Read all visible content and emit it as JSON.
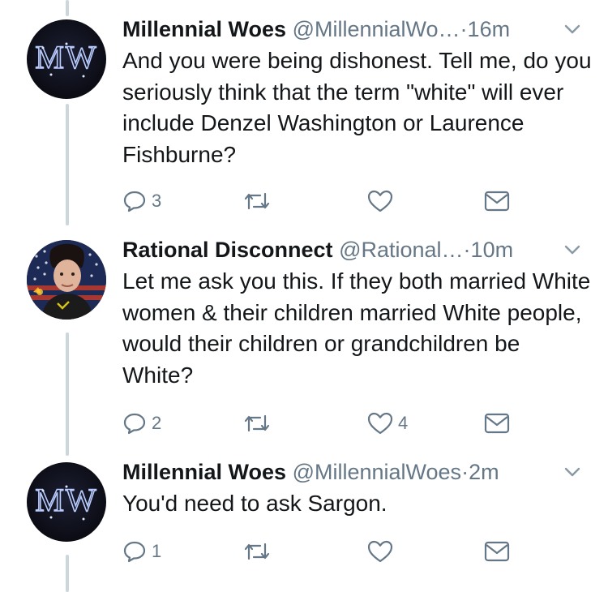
{
  "tweets": [
    {
      "author": "Millennial Woes",
      "handle": "@MillennialWo…",
      "separator": "·",
      "time": "16m",
      "text": "And you were being dishonest. Tell me, do you seriously think that the term \"white\" will ever include Denzel Washington or Laurence Fishburne?",
      "reply_count": "3",
      "retweet_count": "",
      "like_count": "",
      "avatar_letters": "MW"
    },
    {
      "author": "Rational Disconnect",
      "handle": "@Rational…",
      "separator": "·",
      "time": "10m",
      "text": "Let me ask you this. If they both married White women & their children married White people, would their children or grandchildren be White?",
      "reply_count": "2",
      "retweet_count": "",
      "like_count": "4",
      "avatar_letters": ""
    },
    {
      "author": "Millennial Woes",
      "handle": "@MillennialWoes",
      "separator": "·",
      "time": "2m",
      "text": "You'd need to ask Sargon.",
      "reply_count": "1",
      "retweet_count": "",
      "like_count": "",
      "avatar_letters": "MW"
    }
  ],
  "icons": {
    "reply": "reply-icon",
    "retweet": "retweet-icon",
    "like": "heart-icon",
    "message": "envelope-icon",
    "caret": "chevron-down-icon"
  },
  "colors": {
    "text": "#14171a",
    "meta": "#657786",
    "icon": "#657786",
    "thread_line": "#ccd6dd",
    "avatar_glow": "#9fb8ff"
  }
}
